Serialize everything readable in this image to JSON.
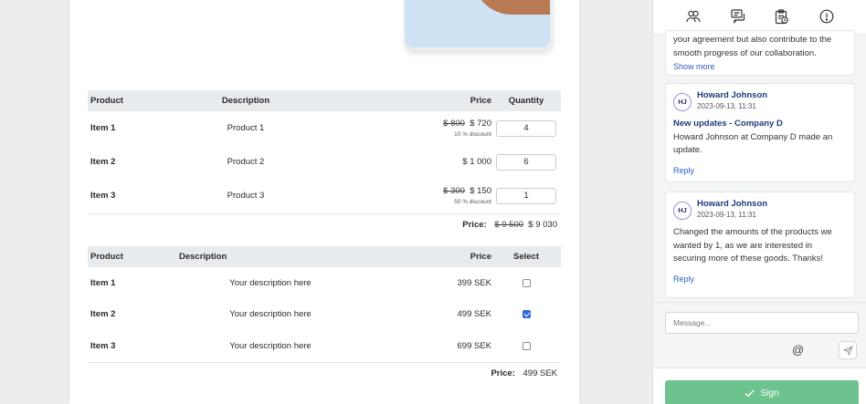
{
  "table1": {
    "headers": [
      "Product",
      "Description",
      "Price",
      "Quantity"
    ],
    "rows": [
      {
        "product": "Item 1",
        "description": "Product 1",
        "old_price": "$ 800",
        "price": "$ 720",
        "discount": "10 % discount",
        "quantity": "4"
      },
      {
        "product": "Item 2",
        "description": "Product 2",
        "old_price": "",
        "price": "$ 1 000",
        "discount": "",
        "quantity": "6"
      },
      {
        "product": "Item 3",
        "description": "Product 3",
        "old_price": "$ 300",
        "price": "$ 150",
        "discount": "50 % discount",
        "quantity": "1"
      }
    ],
    "total_label": "Price:",
    "total_old": "$ 9 500",
    "total_new": "$ 9 030"
  },
  "table2": {
    "headers": [
      "Product",
      "Description",
      "Price",
      "Select"
    ],
    "rows": [
      {
        "product": "Item 1",
        "description": "Your description here",
        "price": "399 SEK",
        "selected": false
      },
      {
        "product": "Item 2",
        "description": "Your description here",
        "price": "499 SEK",
        "selected": true
      },
      {
        "product": "Item 3",
        "description": "Your description here",
        "price": "699 SEK",
        "selected": false
      }
    ],
    "total_label": "Price:",
    "total": "499 SEK"
  },
  "sidebar": {
    "toolbar_icons": [
      "participants-icon",
      "comments-icon",
      "activity-log-icon",
      "info-icon"
    ],
    "comments": [
      {
        "text_top": "your agreement but also contribute to the",
        "text": "smooth progress of our collaboration.",
        "link": "Show more"
      },
      {
        "initials": "HJ",
        "author": "Howard Johnson",
        "date": "2023-09-13, 11:31",
        "title": "New updates - Company D",
        "text": "Howard Johnson at Company D made an update.",
        "link": "Reply"
      },
      {
        "initials": "HJ",
        "author": "Howard Johnson",
        "date": "2023-09-13, 11:31",
        "title": "",
        "text": "Changed the amounts of the products we wanted by 1, as we are interested in securing more of these goods. Thanks!",
        "link": "Reply"
      }
    ],
    "message_placeholder": "Message...",
    "mention_symbol": "@",
    "sign_label": "Sign"
  },
  "colors": {
    "accent": "#2f6bd9",
    "sign": "#6cc38e",
    "author": "#1d3a7a"
  }
}
